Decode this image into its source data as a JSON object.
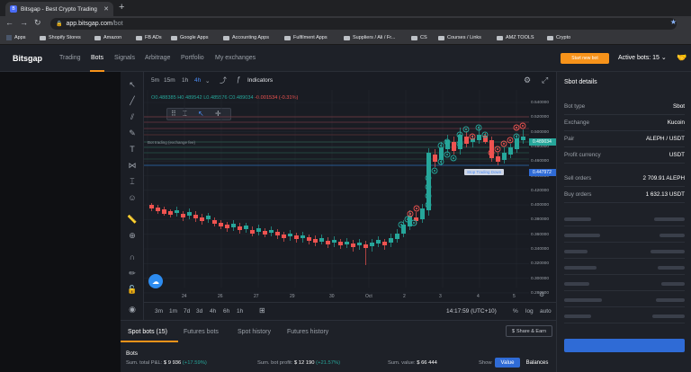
{
  "browser": {
    "tab_title": "Bitsgap - Best Crypto Trading",
    "favicon": "B",
    "url_host": "app.bitsgap.com",
    "url_path": "/bot"
  },
  "bookmarks": [
    "Apps",
    "Shopify Stores",
    "Amazon",
    "FB ADs",
    "Google Apps",
    "Accounting Apps",
    "Fulfilment Apps",
    "Suppliers / Ali / Fr...",
    "CS",
    "Courses / Links",
    "AMZ TOOLS",
    "Crypto"
  ],
  "header": {
    "logo": "Bitsgap",
    "nav": [
      "Trading",
      "Bots",
      "Signals",
      "Arbitrage",
      "Portfolio",
      "My exchanges"
    ],
    "start_bot": "Start new bot",
    "active_bots": "Active bots: 15"
  },
  "chart_toolbar": {
    "timeframes": [
      "5m",
      "15m",
      "1h",
      "4h"
    ],
    "indicators": "Indicators"
  },
  "ohlc": {
    "o": "O0.488385",
    "h": "H0.489542",
    "l": "L0.485576",
    "c": "C0.489034",
    "change": "-0.001534 (-0.31%)"
  },
  "overlay_label": "Bot trading (exchange fee)",
  "stop_label": "Stop Trading Down",
  "price_axis": [
    "0.540000",
    "0.520000",
    "0.500000",
    "0.480000",
    "0.460000",
    "0.440000",
    "0.420000",
    "0.400000",
    "0.380000",
    "0.360000",
    "0.340000",
    "0.320000",
    "0.300000",
    "0.280000"
  ],
  "price_tags": {
    "current": "0.489034",
    "stop": "0.447972"
  },
  "date_axis": [
    "24",
    "26",
    "27",
    "29",
    "30",
    "Oct",
    "2",
    "3",
    "4",
    "5"
  ],
  "ranges": [
    "3m",
    "1m",
    "7d",
    "3d",
    "4h",
    "6h",
    "1h"
  ],
  "time_info": "14:17:59 (UTC+10)",
  "chart_opts": [
    "%",
    "log",
    "auto"
  ],
  "sbot": {
    "title": "Sbot details",
    "rows": [
      {
        "k": "Bot type",
        "v": "Sbot"
      },
      {
        "k": "Exchange",
        "v": "Kucoin"
      },
      {
        "k": "Pair",
        "v": "ALEPH / USDT"
      },
      {
        "k": "Profit currency",
        "v": "USDT"
      },
      {
        "k": "Sell orders",
        "v": "2 709.91 ALEPH"
      },
      {
        "k": "Buy orders",
        "v": "1 632.13 USDT"
      }
    ]
  },
  "bots_panel": {
    "tabs": [
      "Spot bots (15)",
      "Futures bots",
      "Spot history",
      "Futures history"
    ],
    "share": "Share & Earn",
    "title": "Bots",
    "total_pnl_label": "Sum. total P&L:",
    "total_pnl": "$ 9 936",
    "total_pnl_pct": "(+17.59%)",
    "bot_profit_label": "Sum. bot profit:",
    "bot_profit": "$ 12 190",
    "bot_profit_pct": "(+21.57%)",
    "value_label": "Sum. value:",
    "value": "$ 66 444",
    "show_label": "Show",
    "show_opts": [
      "Value",
      "Balances"
    ]
  },
  "colors": {
    "up": "#26a69a",
    "down": "#ef5350",
    "accent": "#f7931a",
    "blue": "#2f6bd6"
  }
}
